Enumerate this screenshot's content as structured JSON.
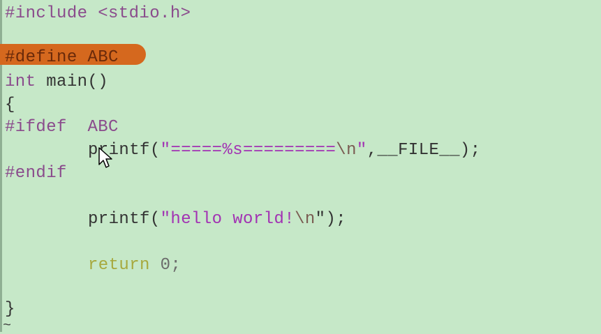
{
  "editor": {
    "lines": {
      "include": "#include <stdio.h>",
      "define": "#define ABC",
      "main_sig": {
        "kw": "int",
        "rest": " main()"
      },
      "brace_open": "{",
      "ifdef": {
        "kw": "#ifdef",
        "arg": "ABC"
      },
      "printf_file": {
        "fn": "printf(",
        "str_open": "\"",
        "str_mid": "=====%s=========",
        "esc": "\\n",
        "str_close": "\"",
        "after": ",__FILE__);"
      },
      "endif": "#endif",
      "printf_hello": {
        "fn": "printf(",
        "str": "\"hello world!",
        "esc": "\\n",
        "close": "\");"
      },
      "return": {
        "kw": "return",
        "val": "0;"
      },
      "brace_close": "}",
      "tilde": "~"
    },
    "highlight_color": "#d5681e",
    "background_color": "#c6e8c8"
  }
}
